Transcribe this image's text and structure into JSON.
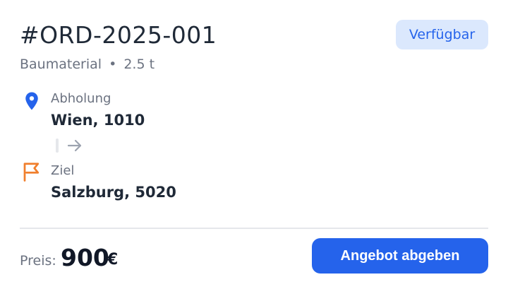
{
  "order": {
    "id": "#ORD-2025-001",
    "cargo_type": "Baumaterial",
    "separator": "•",
    "weight": "2.5 t",
    "status": "Verfügbar"
  },
  "route": {
    "pickup": {
      "label": "Abholung",
      "value": "Wien, 1010",
      "icon": "map-pin-icon"
    },
    "destination": {
      "label": "Ziel",
      "value": "Salzburg, 5020",
      "icon": "flag-icon"
    },
    "connector_icon": "arrow-right-icon"
  },
  "price": {
    "label": "Preis:",
    "amount": "900",
    "currency": "€"
  },
  "actions": {
    "submit_offer_label": "Angebot abgeben"
  },
  "colors": {
    "accent": "#2563eb",
    "badge_bg": "#dbe8fd",
    "destination_icon": "#f07f2d",
    "muted_text": "#6b7280"
  }
}
